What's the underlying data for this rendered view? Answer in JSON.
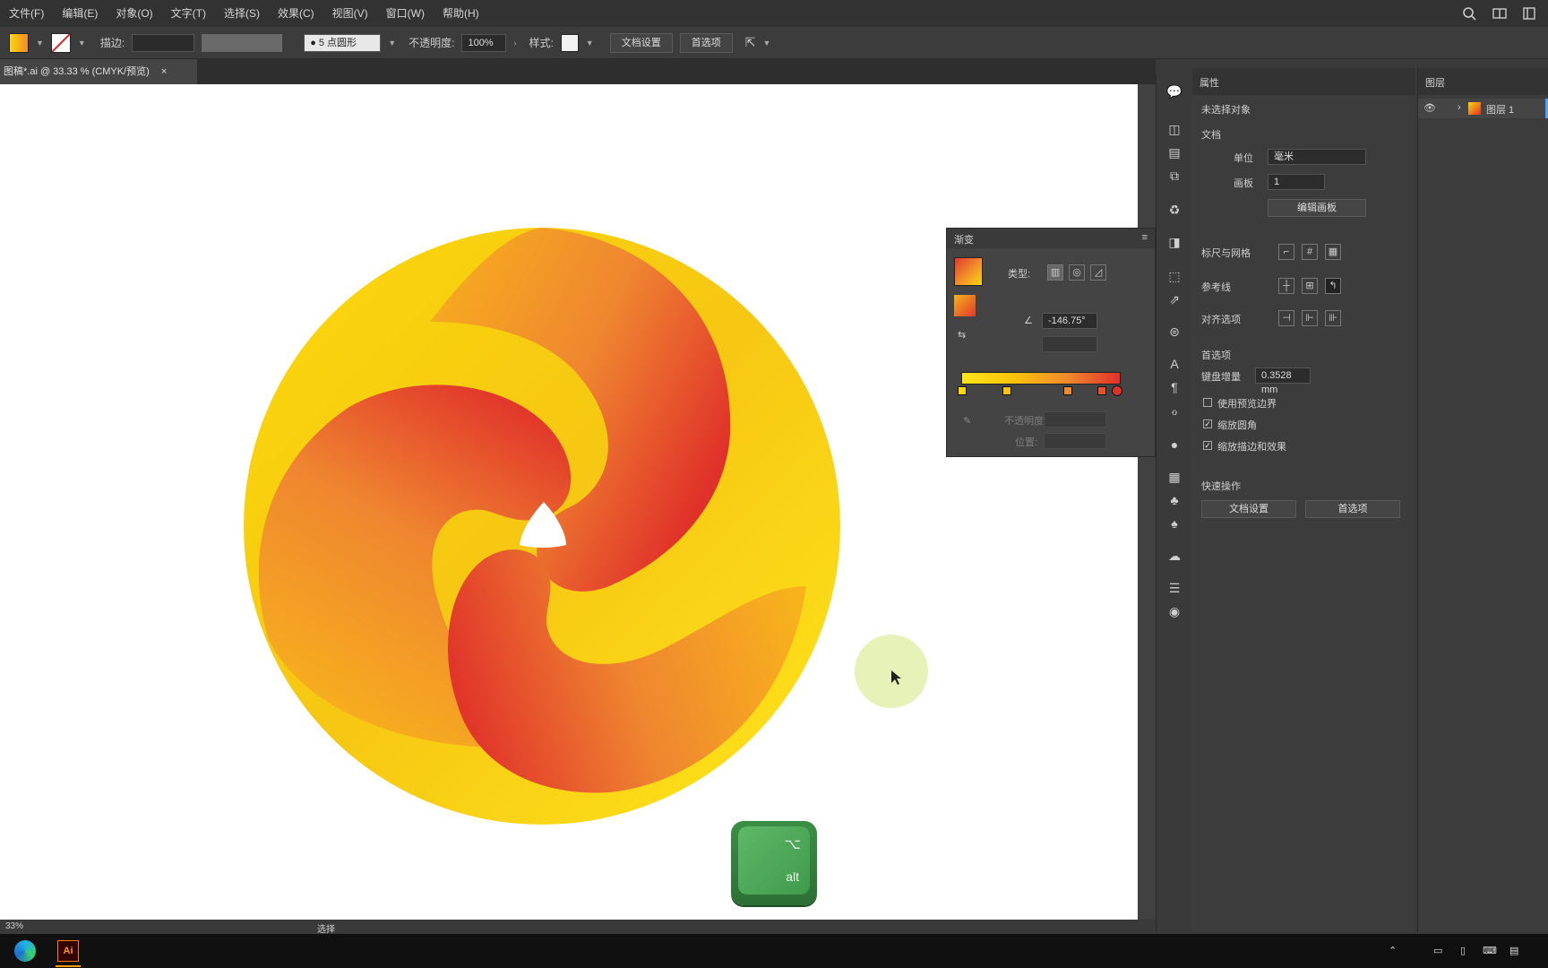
{
  "menubar": {
    "items": [
      "文件(F)",
      "编辑(E)",
      "对象(O)",
      "文字(T)",
      "选择(S)",
      "效果(C)",
      "视图(V)",
      "窗口(W)",
      "帮助(H)"
    ]
  },
  "controlbar": {
    "stroke_label": "描边:",
    "opacity_label": "不透明度:",
    "opacity_value": "100%",
    "style_label": "样式:",
    "uniform_label": "● 5 点圆形",
    "doc_setup_button": "文档设置",
    "prefs_button": "首选项"
  },
  "document": {
    "tab_title": "图稿*.ai @ 33.33 % (CMYK/预览)",
    "close_glyph": "×"
  },
  "properties_panel": {
    "tab_title": "属性",
    "no_selection": "未选择对象",
    "document_section": "文档",
    "units_label": "单位",
    "units_value": "毫米",
    "artboard_label": "画板",
    "artboard_value": "1",
    "edit_artboards_button": "编辑画板",
    "rulers_grids_label": "标尺与网格",
    "guides_label": "参考线",
    "snap_label": "对齐选项",
    "preferences_section": "首选项",
    "keyboard_increment_label": "键盘增量",
    "keyboard_increment_value": "0.3528 mm",
    "scale_corners_label": "使用预览边界",
    "scale_strokes_label": "缩放圆角",
    "scale_effects_label": "缩放描边和效果",
    "quick_actions_section": "快速操作",
    "doc_setup_button": "文档设置",
    "prefs_button": "首选项"
  },
  "layers_panel": {
    "tab_title": "图层",
    "layer_name": "图层 1"
  },
  "gradient_panel": {
    "tab_title": "渐变",
    "type_label": "类型:",
    "angle_value": "-146.75°",
    "opacity_label": "不透明度:",
    "location_label": "位置:"
  },
  "status": {
    "zoom": "33%",
    "tool": "选择"
  },
  "altkey": {
    "symbol": "⌥",
    "label": "alt"
  },
  "colors": {
    "gradient_yellow": "#fbd80a",
    "gradient_orange": "#f08a2c",
    "gradient_red": "#e3362a",
    "ui_dark": "#3c3c3c"
  }
}
